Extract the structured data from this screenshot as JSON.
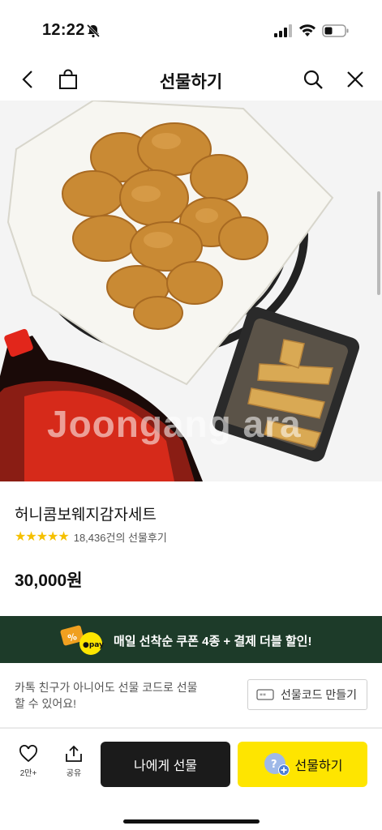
{
  "status": {
    "time": "12:22",
    "icons": [
      "bell-off-icon",
      "signal-icon",
      "wifi-icon",
      "battery-icon"
    ]
  },
  "header": {
    "title": "선물하기",
    "icons": [
      "back-icon",
      "shopping-bag-icon",
      "search-icon",
      "close-icon"
    ]
  },
  "product": {
    "name": "허니콤보웨지감자세트",
    "rating": {
      "stars": "★★★★★",
      "value": 5,
      "review_text": "18,436건의 선물후기"
    },
    "price": "30,000원",
    "watermark": "Joongang ara"
  },
  "banner": {
    "text": "매일 선착순 쿠폰 4종 + 결제 더블 할인!",
    "pay_badge": "pay",
    "bg_color": "#1d3b29"
  },
  "gift_code": {
    "description": "카톡 친구가 아니어도 선물 코드로 선물 할 수 있어요!",
    "button_label": "선물코드 만들기"
  },
  "bottom_bar": {
    "like_count": "2만+",
    "share_label": "공유",
    "self_gift_label": "나에게 선물",
    "gift_label": "선물하기",
    "accent": "#fee500"
  }
}
